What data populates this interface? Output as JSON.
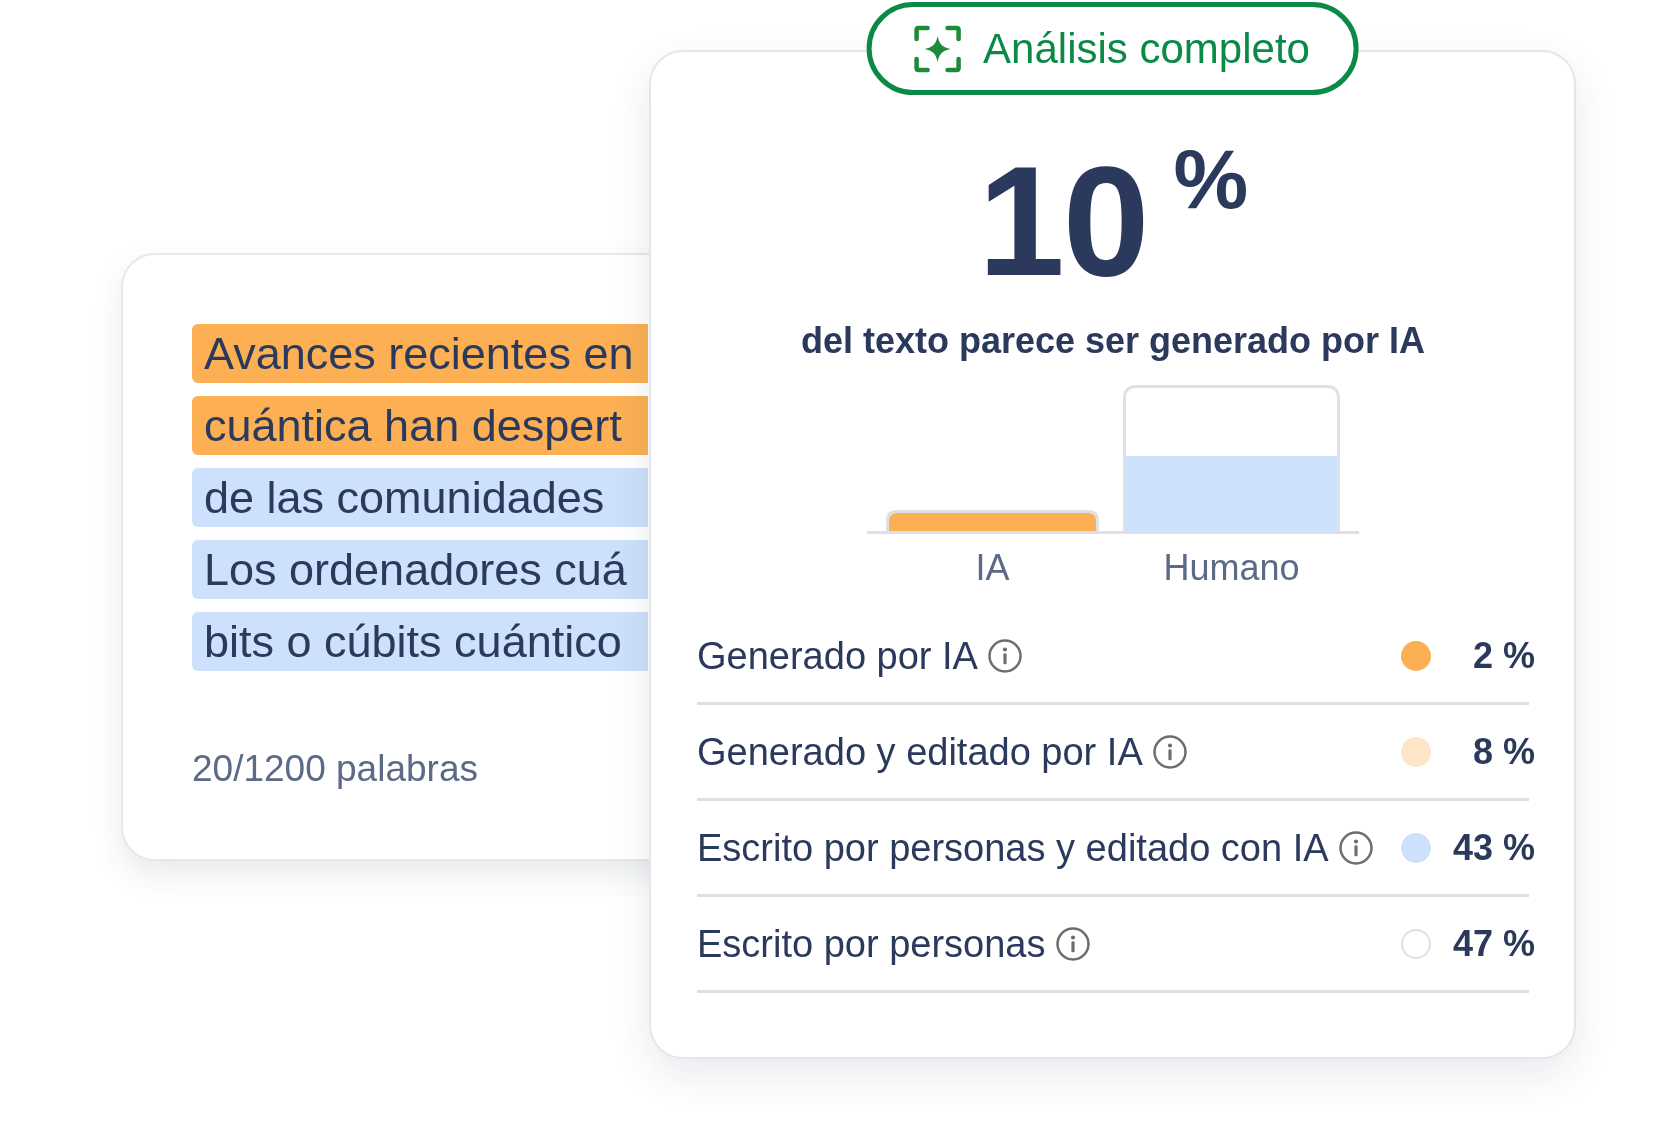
{
  "text_card": {
    "lines": [
      {
        "text": "Avances recientes en",
        "color": "#fcb053"
      },
      {
        "text": "cuántica han despert",
        "color": "#fcb053"
      },
      {
        "text": "de las comunidades",
        "color": "#cde0fc"
      },
      {
        "text": "Los ordenadores cuá",
        "color": "#cde0fc"
      },
      {
        "text": "bits o cúbits cuántico",
        "color": "#cde0fc"
      }
    ],
    "word_count": "20/1200 palabras"
  },
  "result_card": {
    "badge": "Análisis completo",
    "score": "10",
    "unit": "%",
    "caption": "del texto parece ser generado por IA",
    "chart": {
      "labels": [
        "IA",
        "Humano"
      ]
    },
    "breakdown": [
      {
        "label": "Generado por IA",
        "color": "#fcb053",
        "outlined": false,
        "value": "2 %"
      },
      {
        "label": "Generado y editado por IA",
        "color": "#fde6c8",
        "outlined": false,
        "value": "8 %"
      },
      {
        "label": "Escrito por personas y editado con IA",
        "color": "#cde0fc",
        "outlined": false,
        "value": "43 %"
      },
      {
        "label": "Escrito por personas",
        "color": "#ffffff",
        "outlined": true,
        "value": "47 %"
      }
    ]
  }
}
